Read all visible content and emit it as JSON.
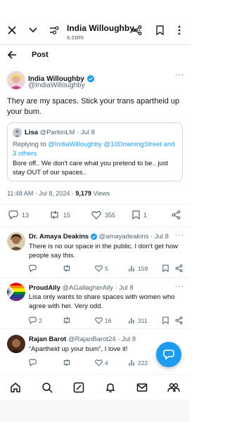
{
  "browser": {
    "title": "India Willoughby...",
    "url": "x.com"
  },
  "header": {
    "label": "Post"
  },
  "post": {
    "author": "India Willoughby",
    "handle": "@IndiaWilloughby",
    "text": "They are my spaces. Stick your trans apartheid up your bum.",
    "quote": {
      "author": "Lisa",
      "handle": "@ParkinLM",
      "date": "· Jul 8",
      "reply_prefix": "Replying to",
      "reply_to": "@IndiaWilloughby @10DowningStreet",
      "reply_suffix": "and 3 others",
      "text": "Bore off.. We don't care what you pretend to be.. just stay OUT of our spaces.."
    },
    "time": "11:48 AM · Jul 8, 2024 ·",
    "views_count": "9,179",
    "views_label": "Views",
    "stats": {
      "replies": "13",
      "reposts": "15",
      "likes": "355",
      "bookmarks": "1"
    }
  },
  "replies": [
    {
      "author": "Dr. Amaya Deakins",
      "handle": "@amayadeakins · Jul 8",
      "text": "There is no our space in the public. I don't get how people say this.",
      "reply_count": "",
      "repost_count": "",
      "like_count": "5",
      "view_count": "159"
    },
    {
      "author": "ProudAlly",
      "handle": "@AGallagherAlly · Jul 8",
      "text": "Lisa only wants to share spaces with women who agree with her. Very odd.",
      "reply_count": "2",
      "repost_count": "",
      "like_count": "16",
      "view_count": "311"
    },
    {
      "author": "Rajan Barot",
      "handle": "@RajanBarot24 · Jul 8",
      "text": "“Apartheid up your bum”, I love it!",
      "reply_count": "",
      "repost_count": "",
      "like_count": "4",
      "view_count": "222"
    }
  ],
  "colors": {
    "accent": "#1d9bf0",
    "text": "#0f1419",
    "muted": "#536471"
  }
}
